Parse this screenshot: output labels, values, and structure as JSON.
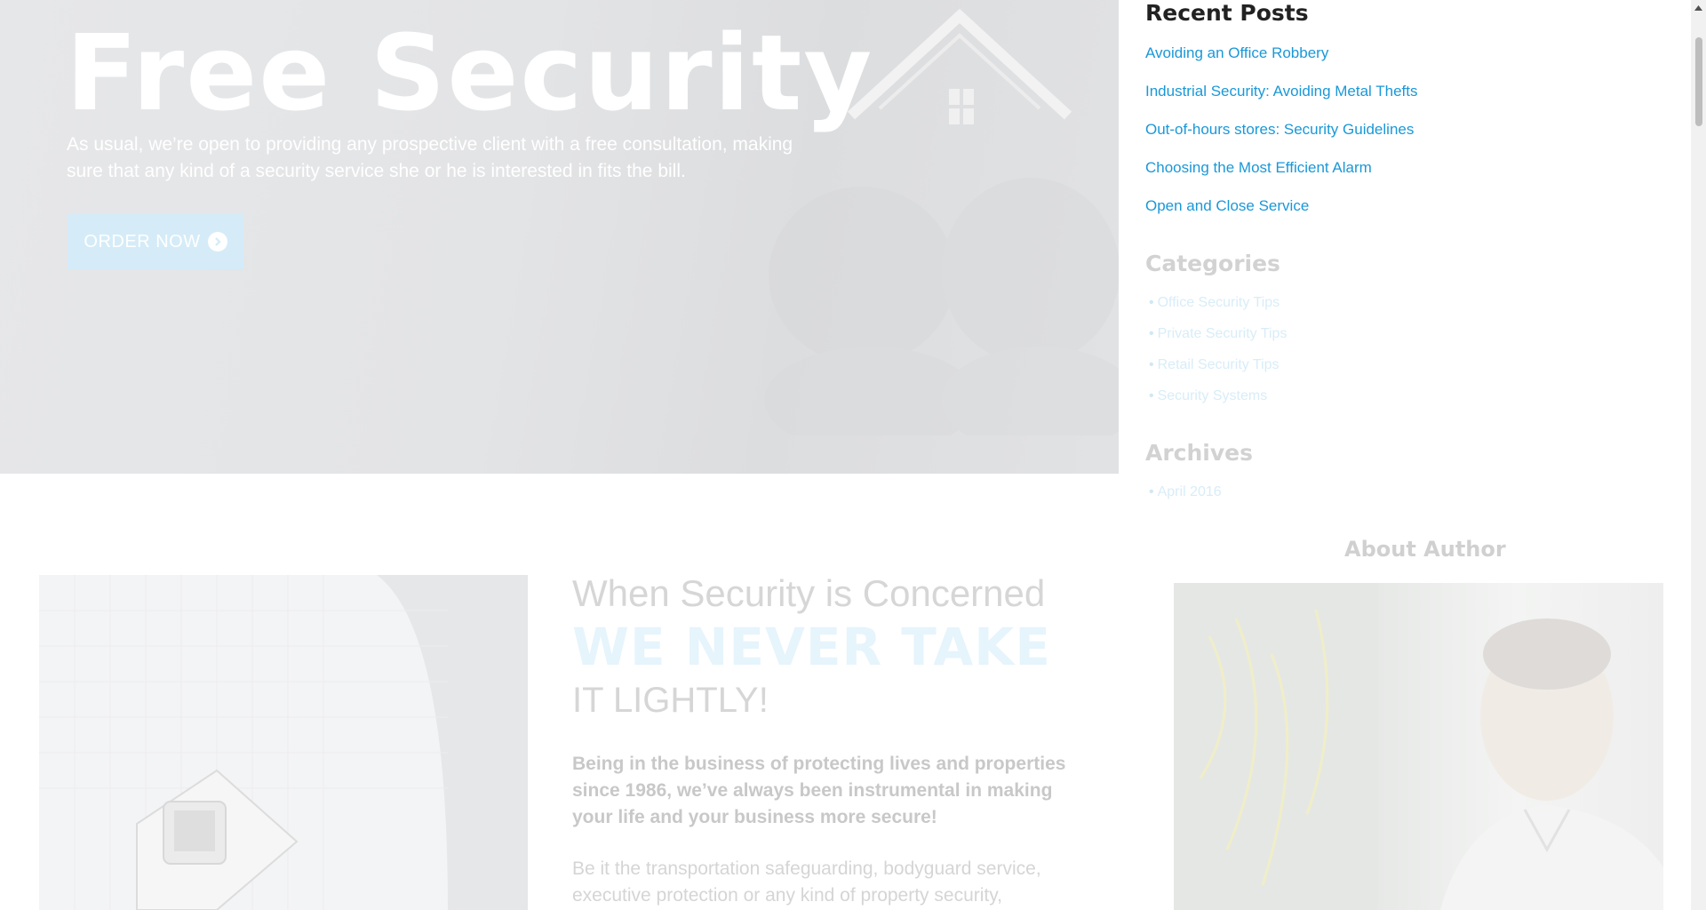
{
  "hero": {
    "title": "Free Security",
    "text": "As usual, we’re open to providing any prospective client with a free consultation, making sure that any kind of a security service she or he is interested in fits the bill.",
    "button_label": "ORDER NOW",
    "button_icon": "chevron-right-circle-icon"
  },
  "sidebar": {
    "recent_posts": {
      "title": "Recent Posts",
      "items": [
        "Avoiding an Office Robbery",
        "Industrial Security: Avoiding Metal Thefts",
        "Out-of-hours stores: Security Guidelines",
        "Choosing the Most Efficient Alarm",
        "Open and Close Service"
      ]
    },
    "categories": {
      "title": "Categories",
      "items": [
        "Office Security Tips",
        "Private Security Tips",
        "Retail Security Tips",
        "Security Systems"
      ]
    },
    "archives": {
      "title": "Archives",
      "items": [
        "April 2016"
      ]
    },
    "about_author": {
      "title": "About Author"
    }
  },
  "content": {
    "heading_line1": "When Security is Concerned",
    "heading_line2": "WE NEVER TAKE",
    "heading_line3": "IT LIGHTLY!",
    "paragraph1": "Being in the business of protecting lives and properties since 1986, we’ve always been instrumental in making your life and your business more secure!",
    "paragraph2": "Be it the transportation safeguarding, bodyguard service, executive protection or any kind of property security,"
  },
  "colors": {
    "link": "#1a98d8",
    "heading_dark": "#222222",
    "hero_bg": "#e3e4e6",
    "button_bg": "#d5ecf8"
  }
}
